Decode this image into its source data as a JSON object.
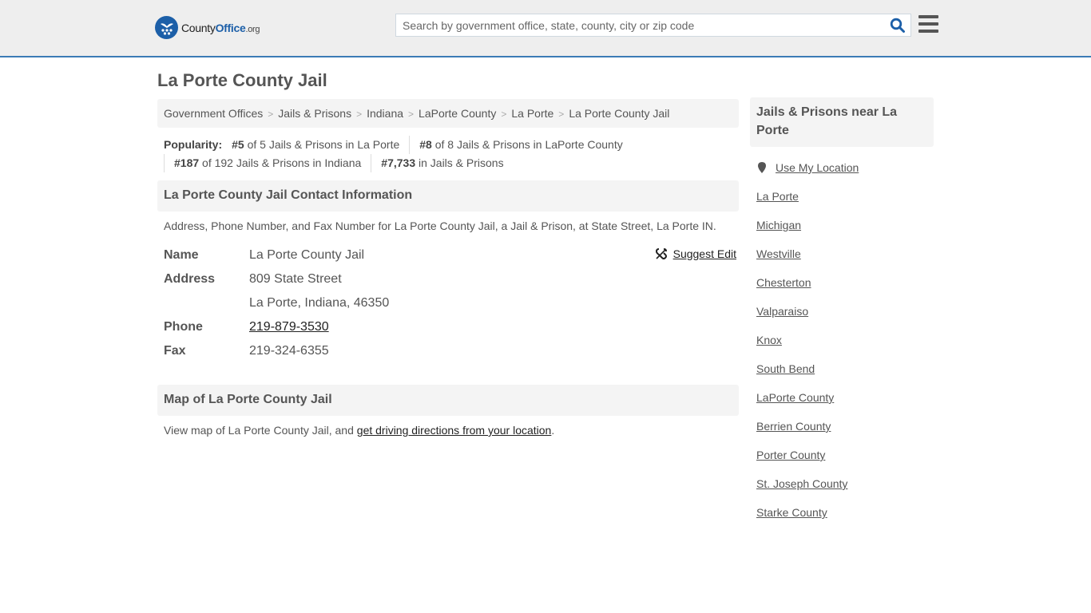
{
  "header": {
    "logo": {
      "name": "County",
      "name_bold": "Office",
      "tld": ".org"
    },
    "search": {
      "placeholder": "Search by government office, state, county, city or zip code",
      "value": ""
    },
    "colors": {
      "brand": "#1c5fa8",
      "border": "#3b7bb5"
    }
  },
  "page": {
    "title": "La Porte County Jail"
  },
  "breadcrumb": [
    {
      "label": "Government Offices"
    },
    {
      "label": "Jails & Prisons"
    },
    {
      "label": "Indiana"
    },
    {
      "label": "LaPorte County"
    },
    {
      "label": "La Porte"
    },
    {
      "label": "La Porte County Jail"
    }
  ],
  "popularity": {
    "label": "Popularity:",
    "items": [
      {
        "rank": "#5",
        "text": "of 5 Jails & Prisons in La Porte"
      },
      {
        "rank": "#8",
        "text": "of 8 Jails & Prisons in LaPorte County"
      },
      {
        "rank": "#187",
        "text": "of 192 Jails & Prisons in Indiana"
      },
      {
        "rank": "#7,733",
        "text": "in Jails & Prisons"
      }
    ]
  },
  "contact": {
    "heading": "La Porte County Jail Contact Information",
    "description": "Address, Phone Number, and Fax Number for La Porte County Jail, a Jail & Prison, at State Street, La Porte IN.",
    "suggest_edit": "Suggest Edit",
    "rows": {
      "name_label": "Name",
      "name": "La Porte County Jail",
      "address_label": "Address",
      "address_line1": "809 State Street",
      "address_line2": "La Porte, Indiana, 46350",
      "phone_label": "Phone",
      "phone": "219-879-3530",
      "fax_label": "Fax",
      "fax": "219-324-6355"
    }
  },
  "map": {
    "heading": "Map of La Porte County Jail",
    "text_before": "View map of La Porte County Jail, and ",
    "link": "get driving directions from your location",
    "text_after": "."
  },
  "sidebar": {
    "heading": "Jails & Prisons near La Porte",
    "use_location": "Use My Location",
    "links": [
      "La Porte",
      "Michigan",
      "Westville",
      "Chesterton",
      "Valparaiso",
      "Knox",
      "South Bend",
      "LaPorte County",
      "Berrien County",
      "Porter County",
      "St. Joseph County",
      "Starke County"
    ]
  }
}
